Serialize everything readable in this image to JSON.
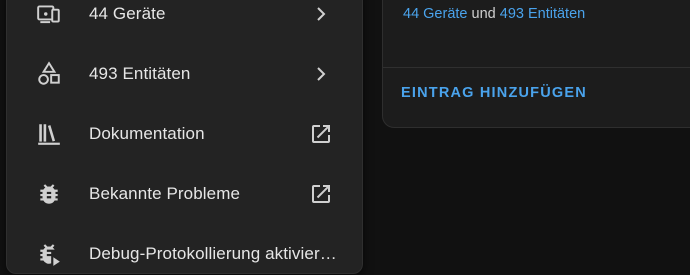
{
  "menu": {
    "items": [
      {
        "label": "44 Geräte",
        "icon": "devices-icon",
        "trailing": "chevron-right-icon"
      },
      {
        "label": "493 Entitäten",
        "icon": "shapes-icon",
        "trailing": "chevron-right-icon"
      },
      {
        "label": "Dokumentation",
        "icon": "bookshelf-icon",
        "trailing": "open-in-new-icon"
      },
      {
        "label": "Bekannte Probleme",
        "icon": "bug-icon",
        "trailing": "open-in-new-icon"
      },
      {
        "label": "Debug-Protokollierung aktivier…",
        "icon": "bug-play-icon",
        "trailing": ""
      }
    ]
  },
  "card": {
    "devices_link": "44 Geräte",
    "connector": " und ",
    "entities_link": "493 Entitäten",
    "add_entry_label": "EINTRAG HINZUFÜGEN"
  },
  "colors": {
    "accent": "#4aa3ec",
    "panel": "#232323",
    "background": "#111111",
    "icon": "#d0d0d0"
  }
}
